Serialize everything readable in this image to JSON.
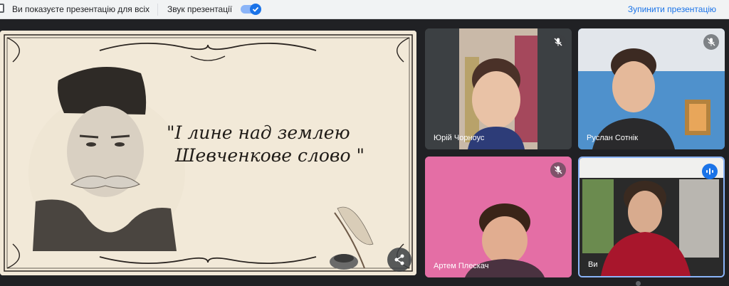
{
  "topbar": {
    "show_all_label": "Ви показуєте презентацію для всіх",
    "sound_label": "Звук презентації",
    "stop_label": "Зупинити презентацію"
  },
  "slide": {
    "quote_line1": "\"І лине над землею",
    "quote_line2": "Шевченкове слово \""
  },
  "participants": [
    {
      "name": "Юрій Чорноус"
    },
    {
      "name": "Руслан Сотнік"
    },
    {
      "name": "Артем Плескач"
    },
    {
      "name": "Ви"
    }
  ],
  "colors": {
    "accent": "#1a73e8",
    "stage": "#202124",
    "slide_paper": "#f2e9d8"
  }
}
